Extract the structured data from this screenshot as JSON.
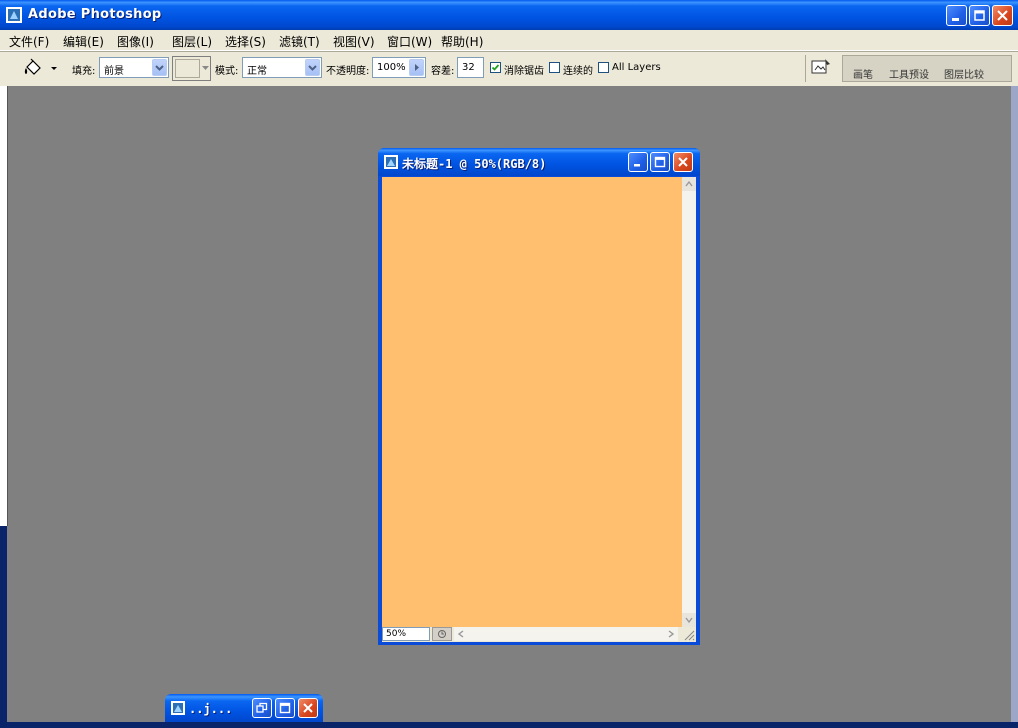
{
  "app": {
    "title": "Adobe Photoshop",
    "accent_color": "#0054E3",
    "workspace_color": "#808080"
  },
  "menu": {
    "items": [
      {
        "label": "文件(F)"
      },
      {
        "label": "编辑(E)"
      },
      {
        "label": "图像(I)"
      },
      {
        "label": "图层(L)"
      },
      {
        "label": "选择(S)"
      },
      {
        "label": "滤镜(T)"
      },
      {
        "label": "视图(V)"
      },
      {
        "label": "窗口(W)"
      },
      {
        "label": "帮助(H)"
      }
    ]
  },
  "options": {
    "tool_icon": "paint-bucket-icon",
    "fill_label": "填充:",
    "fill_value": "前景",
    "mode_label": "模式:",
    "mode_value": "正常",
    "opacity_label": "不透明度:",
    "opacity_value": "100%",
    "tolerance_label": "容差:",
    "tolerance_value": "32",
    "antialias_label": "消除锯齿",
    "antialias_checked": true,
    "contiguous_label": "连续的",
    "contiguous_checked": false,
    "all_layers_label": "All Layers",
    "all_layers_checked": false,
    "pattern_swatch_color": "#ECE9D8"
  },
  "panel_tabs": [
    {
      "label": "画笔"
    },
    {
      "label": "工具预设"
    },
    {
      "label": "图层比较"
    }
  ],
  "document": {
    "title": "未标题-1 @ 50%(RGB/8)",
    "canvas_color": "#FFBF6F",
    "zoom": "50%"
  },
  "minimized": {
    "title": "..j..."
  }
}
